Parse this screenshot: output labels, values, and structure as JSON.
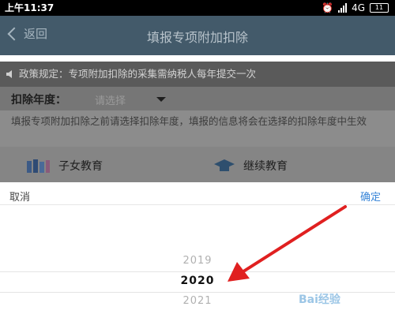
{
  "status_bar": {
    "time": "上午11:37",
    "network": "4G",
    "battery": "11"
  },
  "app_bar": {
    "back_label": "返回",
    "title": "填报专项附加扣除"
  },
  "notice": {
    "text": "政策规定：专项附加扣除的采集需纳税人每年提交一次"
  },
  "deduction_year": {
    "label": "扣除年度：",
    "placeholder": "请选择"
  },
  "description": "填报专项附加扣除之前请选择扣除年度，填报的信息将会在选择的扣除年度中生效",
  "categories": [
    {
      "label": "子女教育",
      "icon": "books-icon"
    },
    {
      "label": "继续教育",
      "icon": "graduation-cap-icon"
    }
  ],
  "picker": {
    "cancel_label": "取消",
    "confirm_label": "确定",
    "options": [
      "2019",
      "2020",
      "2021"
    ],
    "selected": "2020"
  },
  "watermark": "Bai经验",
  "colors": {
    "confirm": "#3a86d8",
    "arrow": "#e02020"
  }
}
